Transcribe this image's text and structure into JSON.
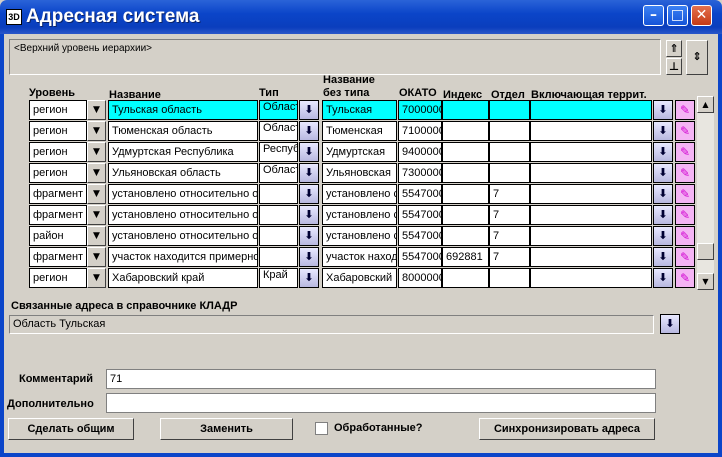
{
  "window": {
    "title": "Адресная система",
    "icon": "app-icon",
    "minimize_icon": "minimize-icon",
    "maximize_icon": "maximize-icon",
    "close_icon": "close-icon"
  },
  "hierarchy": {
    "value": "<Верхний уровень иерархии>",
    "up_icon": "up-arrow-icon",
    "top_icon": "to-top-icon"
  },
  "columns": {
    "level": "Уровень",
    "name": "Название",
    "type": "Тип",
    "name_no_type_1": "Название",
    "name_no_type_2": "без типа",
    "okato": "ОКАТО",
    "index": "Индекс",
    "dept": "Отдел",
    "incl": "Включающая террит."
  },
  "rows": [
    {
      "level": "регион",
      "name": "Тульская область",
      "type": "Област",
      "short": "Тульская",
      "okato": "7000000",
      "index": "",
      "dept": "",
      "incl": "",
      "selected": true
    },
    {
      "level": "регион",
      "name": "Тюменская область",
      "type": "Област",
      "short": "Тюменская",
      "okato": "7100000",
      "index": "",
      "dept": "",
      "incl": ""
    },
    {
      "level": "регион",
      "name": "Удмуртская Республика",
      "type": "Респуб",
      "short": "Удмуртская",
      "okato": "9400000",
      "index": "",
      "dept": "",
      "incl": ""
    },
    {
      "level": "регион",
      "name": "Ульяновская область",
      "type": "Област",
      "short": "Ульяновская",
      "okato": "7300000",
      "index": "",
      "dept": "",
      "incl": ""
    },
    {
      "level": "фрагмент",
      "name": "установлено относительно о",
      "type": "",
      "short": "установлено с",
      "okato": "5547000",
      "index": "",
      "dept": "7",
      "incl": ""
    },
    {
      "level": "фрагмент",
      "name": "установлено относительно о",
      "type": "",
      "short": "установлено с",
      "okato": "5547000",
      "index": "",
      "dept": "7",
      "incl": ""
    },
    {
      "level": "район",
      "name": "установлено относительно о",
      "type": "",
      "short": "установлено с",
      "okato": "5547000",
      "index": "",
      "dept": "7",
      "incl": ""
    },
    {
      "level": "фрагмент",
      "name": "участок находится примерно",
      "type": "",
      "short": "участок наход...",
      "okato": "5547000",
      "index": "692881",
      "dept": "7",
      "incl": ""
    },
    {
      "level": "регион",
      "name": "Хабаровский край",
      "type": "Край",
      "short": "Хабаровский",
      "okato": "8000000",
      "index": "",
      "dept": "",
      "incl": ""
    }
  ],
  "kladr": {
    "label": "Связанные адреса в справочнике КЛАДР",
    "value": "Область Тульская"
  },
  "comment": {
    "label": "Комментарий",
    "value": "71"
  },
  "extra": {
    "label": "Дополнительно",
    "value": ""
  },
  "buttons": {
    "make_common": "Сделать общим",
    "replace": "Заменить",
    "processed": "Обработанные?",
    "sync": "Синхронизировать адреса"
  }
}
